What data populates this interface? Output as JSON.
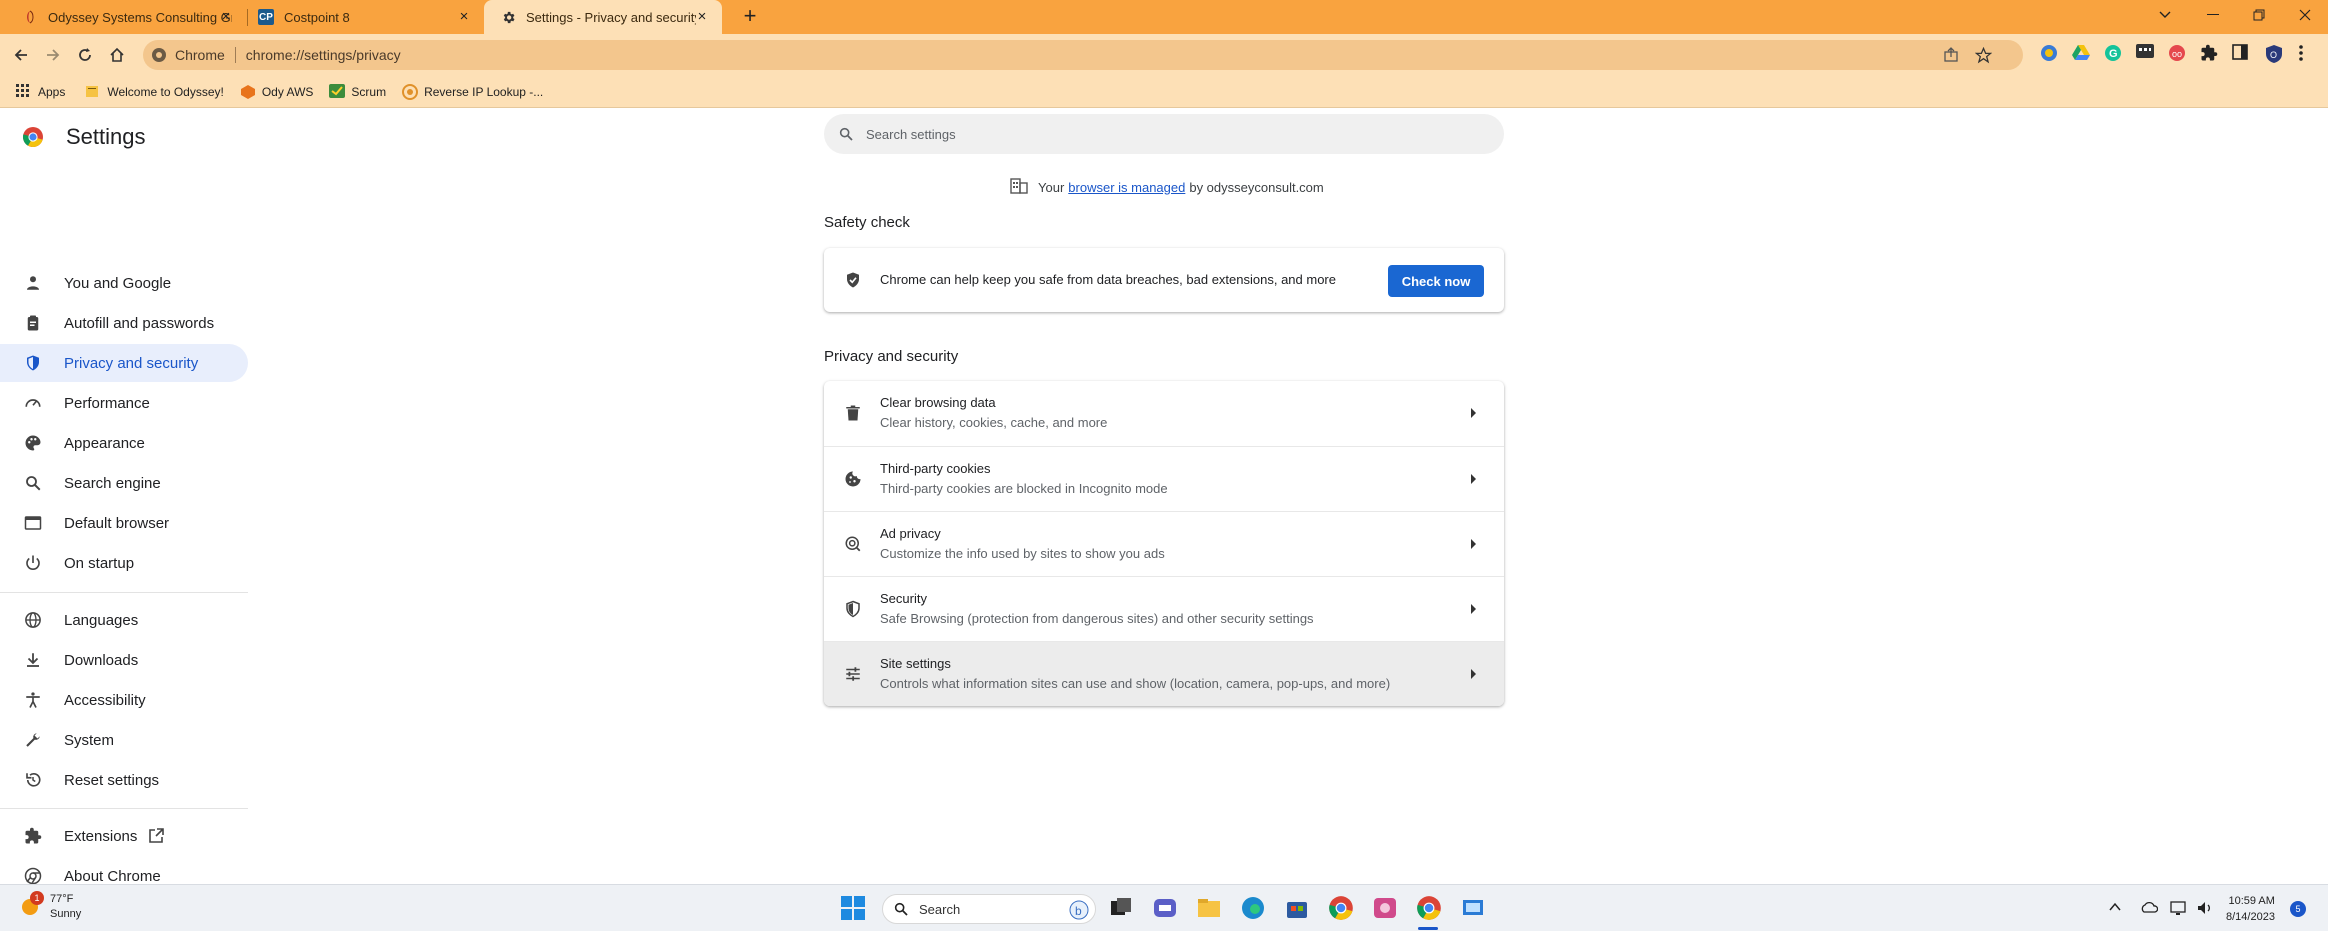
{
  "browser": {
    "tabs": [
      {
        "title": "Odyssey Systems Consulting Gro",
        "icon": "odyssey-favicon",
        "active": false
      },
      {
        "title": "Costpoint 8",
        "icon": "costpoint-favicon",
        "active": false
      },
      {
        "title": "Settings - Privacy and security",
        "icon": "gear-icon",
        "active": true
      }
    ],
    "omnibox": {
      "chip": "Chrome",
      "url": "chrome://settings/privacy"
    },
    "bookmarks": [
      {
        "label": "Apps",
        "icon": "apps-grid-icon"
      },
      {
        "label": "Welcome to Odyssey!",
        "icon": "folder-icon"
      },
      {
        "label": "Ody AWS",
        "icon": "aws-icon"
      },
      {
        "label": "Scrum",
        "icon": "scrum-icon"
      },
      {
        "label": "Reverse IP Lookup -...",
        "icon": "reverse-ip-icon"
      }
    ]
  },
  "settings": {
    "title": "Settings",
    "search_placeholder": "Search settings",
    "managed": {
      "prefix": "Your",
      "link": "browser is managed",
      "suffix": "by odysseyconsult.com"
    },
    "nav_group1": [
      {
        "label": "You and Google",
        "icon": "person-icon"
      },
      {
        "label": "Autofill and passwords",
        "icon": "clipboard-icon"
      },
      {
        "label": "Privacy and security",
        "icon": "shield-icon",
        "selected": true
      },
      {
        "label": "Performance",
        "icon": "speedometer-icon"
      },
      {
        "label": "Appearance",
        "icon": "palette-icon"
      },
      {
        "label": "Search engine",
        "icon": "search-icon"
      },
      {
        "label": "Default browser",
        "icon": "browser-window-icon"
      },
      {
        "label": "On startup",
        "icon": "power-icon"
      }
    ],
    "nav_group2": [
      {
        "label": "Languages",
        "icon": "globe-icon"
      },
      {
        "label": "Downloads",
        "icon": "download-icon"
      },
      {
        "label": "Accessibility",
        "icon": "accessibility-icon"
      },
      {
        "label": "System",
        "icon": "wrench-icon"
      },
      {
        "label": "Reset settings",
        "icon": "reset-history-icon"
      }
    ],
    "nav_group3": [
      {
        "label": "Extensions",
        "icon": "puzzle-icon"
      },
      {
        "label": "About Chrome",
        "icon": "chrome-icon"
      }
    ],
    "safety_check": {
      "heading": "Safety check",
      "text": "Chrome can help keep you safe from data breaches, bad extensions, and more",
      "button": "Check now"
    },
    "privacy": {
      "heading": "Privacy and security",
      "rows": [
        {
          "title": "Clear browsing data",
          "subtitle": "Clear history, cookies, cache, and more",
          "icon": "trash-icon"
        },
        {
          "title": "Third-party cookies",
          "subtitle": "Third-party cookies are blocked in Incognito mode",
          "icon": "cookie-icon"
        },
        {
          "title": "Ad privacy",
          "subtitle": "Customize the info used by sites to show you ads",
          "icon": "ad-privacy-icon"
        },
        {
          "title": "Security",
          "subtitle": "Safe Browsing (protection from dangerous sites) and other security settings",
          "icon": "shield-icon"
        },
        {
          "title": "Site settings",
          "subtitle": "Controls what information sites can use and show (location, camera, pop-ups, and more)",
          "icon": "sliders-icon",
          "hovered": true
        }
      ]
    }
  },
  "taskbar": {
    "weather": {
      "temp": "77°F",
      "condition": "Sunny",
      "badge": "1"
    },
    "search_placeholder": "Search",
    "time": "10:59 AM",
    "date": "8/14/2023",
    "notification_count": "5"
  },
  "colors": {
    "tabstrip": "#f9a33f",
    "toolbar": "#fde0b6",
    "accent": "#1a67d2",
    "selected_nav_bg": "#e8eefc"
  }
}
